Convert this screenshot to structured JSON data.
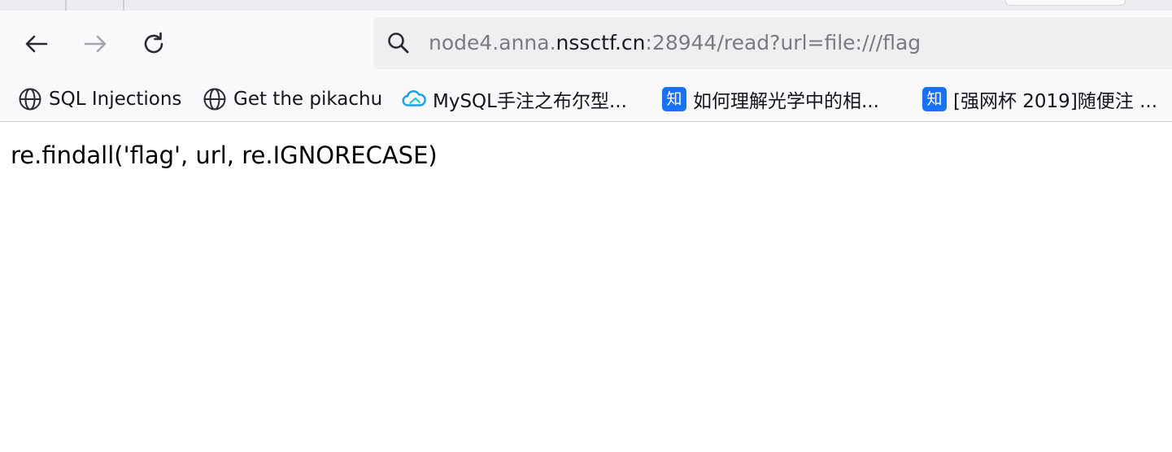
{
  "toolbar": {
    "back_icon": "arrow-left-icon",
    "forward_icon": "arrow-right-icon",
    "reload_icon": "reload-icon",
    "search_icon": "search-icon"
  },
  "urlbar": {
    "prefix": "node4.anna.",
    "host": "nssctf.cn",
    "suffix": ":28944/read?url=file:///flag"
  },
  "bookmarks": [
    {
      "label": "SQL Injections",
      "icon": "globe-icon"
    },
    {
      "label": "Get the pikachu",
      "icon": "globe-icon"
    },
    {
      "label": "MySQL手注之布尔型...",
      "icon": "cloud-icon"
    },
    {
      "label": "如何理解光学中的相...",
      "icon": "zhihu-icon",
      "icon_text": "知"
    },
    {
      "label": "[强网杯 2019]随便注 ...",
      "icon": "zhihu-icon",
      "icon_text": "知"
    }
  ],
  "page": {
    "body_text": "re.findall('flag', url, re.IGNORECASE)"
  },
  "colors": {
    "toolbar_bg": "#f9f9fb",
    "urlbar_bg": "#efeff2",
    "zhihu_blue": "#1772f6",
    "cloud_teal": "#19a0e6"
  }
}
